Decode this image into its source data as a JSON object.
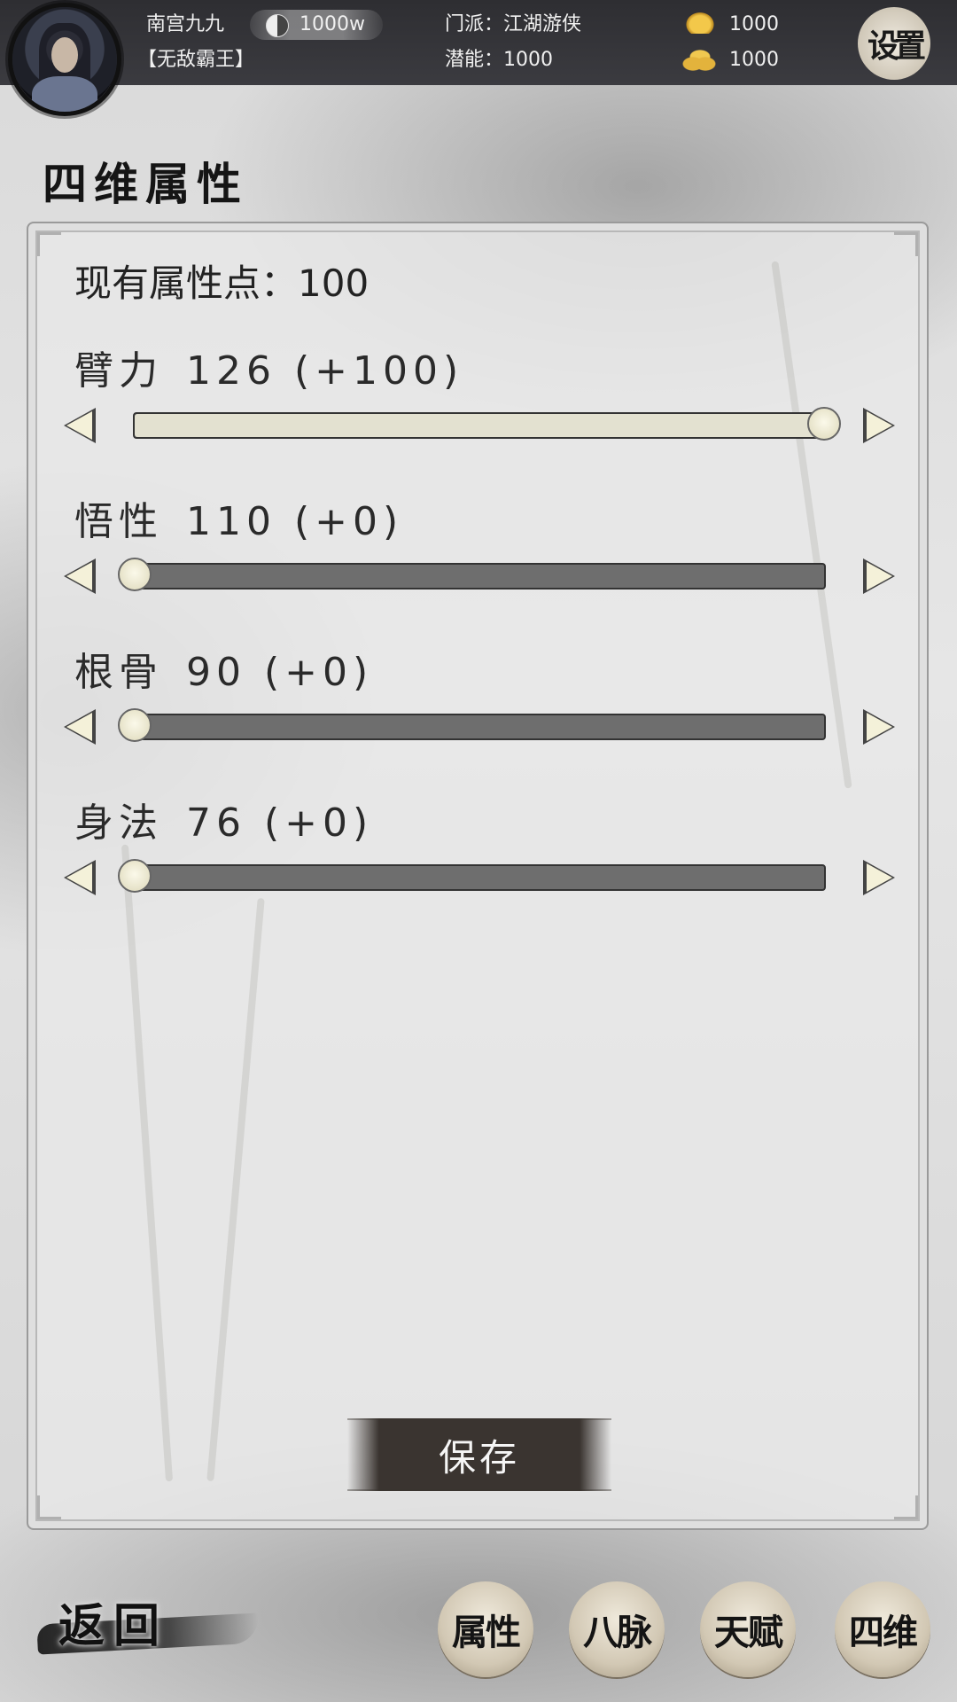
{
  "header": {
    "player_name": "南宫九九",
    "player_title": "【无敌霸王】",
    "power": "1000w",
    "sect": "门派：江湖游侠",
    "potential": "潜能：1000",
    "gold": "1000",
    "coins": "1000",
    "settings_label": "设置"
  },
  "page_title": "四维属性",
  "attribute_points": "现有属性点：100",
  "stats": [
    {
      "label": "臂力",
      "value": "126 (+100)",
      "fill": 1.0
    },
    {
      "label": "悟性",
      "value": "110 (+0)",
      "fill": 0.0
    },
    {
      "label": "根骨",
      "value": "90 (+0)",
      "fill": 0.0
    },
    {
      "label": "身法",
      "value": "76 (+0)",
      "fill": 0.0
    }
  ],
  "save_label": "保存",
  "back_label": "返回",
  "tabs": [
    {
      "label": "属性"
    },
    {
      "label": "八脉"
    },
    {
      "label": "天赋"
    },
    {
      "label": "四维"
    }
  ],
  "colors": {
    "track": "#6e6e6e",
    "fill": "#e3e1d0",
    "topbar": "#34343a"
  },
  "icons": [
    "avatar",
    "yin-yang-icon",
    "gold-ingot-icon",
    "coins-icon"
  ]
}
